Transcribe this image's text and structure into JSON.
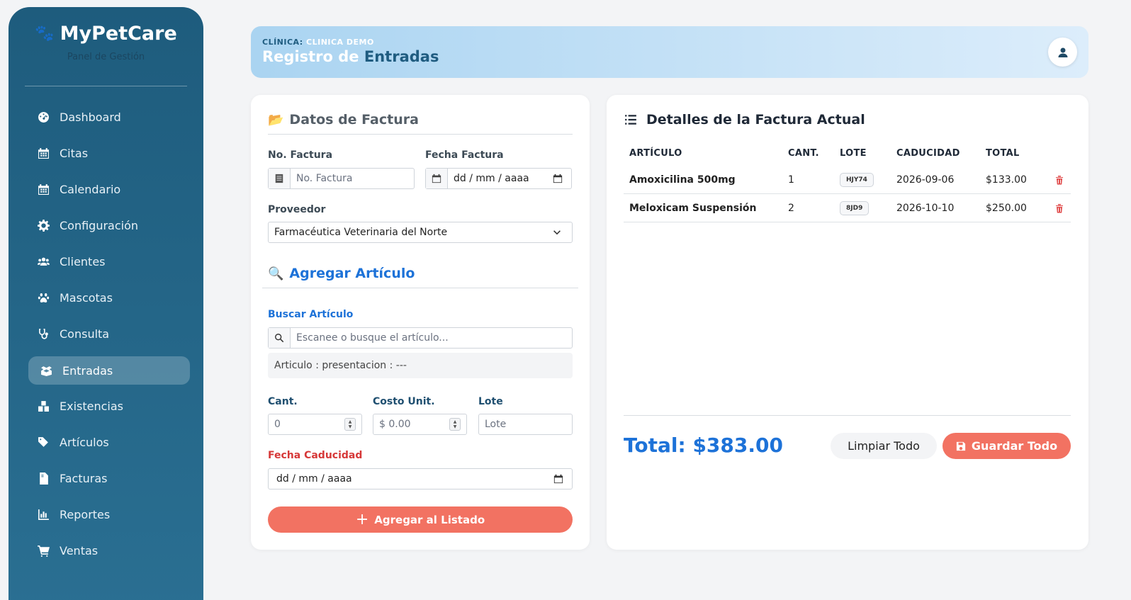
{
  "sidebar": {
    "brand": "MyPetCare",
    "subtitle": "Panel de Gestión",
    "items": [
      {
        "label": "Dashboard",
        "icon": "dashboard-icon"
      },
      {
        "label": "Citas",
        "icon": "calendar-icon"
      },
      {
        "label": "Calendario",
        "icon": "calendar-icon"
      },
      {
        "label": "Configuración",
        "icon": "gear-icon"
      },
      {
        "label": "Clientes",
        "icon": "users-icon"
      },
      {
        "label": "Mascotas",
        "icon": "paw-icon"
      },
      {
        "label": "Consulta",
        "icon": "stethoscope-icon"
      },
      {
        "label": "Entradas",
        "icon": "boxes-icon",
        "active": true
      },
      {
        "label": "Existencias",
        "icon": "stock-icon"
      },
      {
        "label": "Artículos",
        "icon": "tags-icon"
      },
      {
        "label": "Facturas",
        "icon": "invoice-icon"
      },
      {
        "label": "Reportes",
        "icon": "chart-icon"
      },
      {
        "label": "Ventas",
        "icon": "cart-icon"
      }
    ]
  },
  "header": {
    "clinic_label": "CLÍNICA:",
    "clinic_name": "CLINICA DEMO",
    "title_a": "Registro de",
    "title_b": "Entradas"
  },
  "invoice_form": {
    "title": "Datos de Factura",
    "no_factura_label": "No. Factura",
    "no_factura_placeholder": "No. Factura",
    "fecha_factura_label": "Fecha Factura",
    "fecha_factura_placeholder": "dd / mm / aaaa",
    "proveedor_label": "Proveedor",
    "proveedor_value": "Farmacéutica Veterinaria del Norte"
  },
  "add_item": {
    "title": "Agregar Artículo",
    "search_label": "Buscar Artículo",
    "search_placeholder": "Escanee o busque el artículo...",
    "info": "Articulo : presentacion : ---",
    "cant_label": "Cant.",
    "cant_value": "0",
    "costo_label": "Costo Unit.",
    "costo_value": "$ 0.00",
    "lote_label": "Lote",
    "lote_placeholder": "Lote",
    "caducidad_label": "Fecha Caducidad",
    "caducidad_placeholder": "dd / mm / aaaa",
    "add_button": "Agregar al Listado"
  },
  "details": {
    "title": "Detalles de la Factura Actual",
    "columns": [
      "ARTÍCULO",
      "CANT.",
      "LOTE",
      "CADUCIDAD",
      "TOTAL"
    ],
    "rows": [
      {
        "articulo": "Amoxicilina 500mg",
        "cant": "1",
        "lote": "HJY74",
        "caducidad": "2026-09-06",
        "total": "$133.00"
      },
      {
        "articulo": "Meloxicam Suspensión",
        "cant": "2",
        "lote": "8JD9",
        "caducidad": "2026-10-10",
        "total": "$250.00"
      }
    ],
    "total": "Total: $383.00",
    "clear_button": "Limpiar Todo",
    "save_button": "Guardar Todo"
  },
  "colors": {
    "sidebar": "#1e5c7d",
    "accent": "#f27262",
    "primary_blue": "#1d72d8"
  }
}
